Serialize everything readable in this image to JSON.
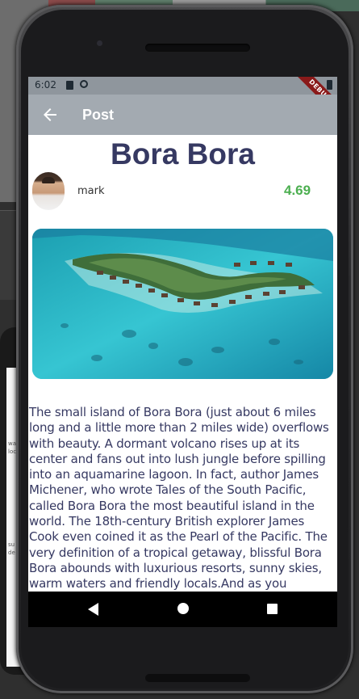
{
  "status_bar": {
    "time": "6:02",
    "debug_label": "DEBUG"
  },
  "appbar": {
    "title": "Post",
    "back_icon": "arrow-left-icon"
  },
  "post": {
    "title": "Bora Bora",
    "author": "mark",
    "rating": "4.69",
    "rating_color": "#4caf50",
    "title_color": "#363962",
    "image_alt": "Overwater bungalows in turquoise lagoon",
    "body": "The small island of Bora Bora (just about 6 miles long and a little more than 2 miles wide) overflows with beauty. A dormant volcano rises up at its center and fans out into lush jungle before spilling into an aquamarine lagoon. In fact, author James Michener, who wrote Tales of the South Pacific, called Bora Bora the most beautiful island in the world. The 18th-century British explorer James Cook even coined it as the Pearl of the Pacific. The very definition of a tropical getaway, blissful Bora Bora abounds with luxurious resorts, sunny skies, warm waters and friendly locals.And as you"
  },
  "nav": {
    "back": "nav-back-icon",
    "home": "nav-home-icon",
    "recents": "nav-recents-icon"
  },
  "background_phone": {
    "text1": "wa",
    "text2": "loc",
    "text3": "su",
    "text4": "de"
  }
}
